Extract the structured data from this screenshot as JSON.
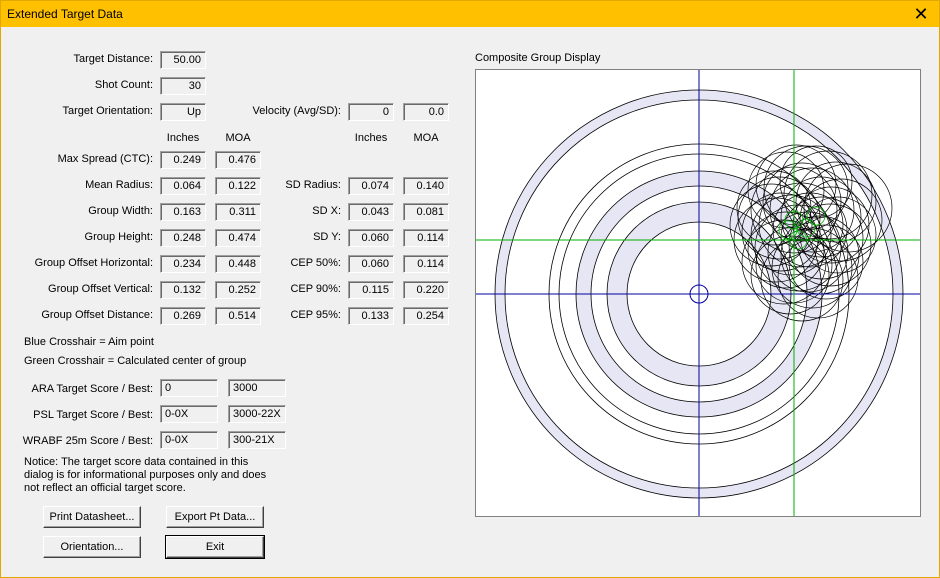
{
  "window": {
    "title": "Extended Target Data",
    "close_glyph": "✕"
  },
  "top": {
    "target_distance_label": "Target Distance:",
    "target_distance": "50.00",
    "shot_count_label": "Shot Count:",
    "shot_count": "30",
    "target_orientation_label": "Target Orientation:",
    "target_orientation": "Up",
    "velocity_label": "Velocity (Avg/SD):",
    "velocity_avg": "0",
    "velocity_sd": "0.0"
  },
  "headers": {
    "inches": "Inches",
    "moa": "MOA"
  },
  "left_rows": [
    {
      "label": "Max Spread (CTC):",
      "inches": "0.249",
      "moa": "0.476"
    },
    {
      "label": "Mean Radius:",
      "inches": "0.064",
      "moa": "0.122"
    },
    {
      "label": "Group Width:",
      "inches": "0.163",
      "moa": "0.311"
    },
    {
      "label": "Group Height:",
      "inches": "0.248",
      "moa": "0.474"
    },
    {
      "label": "Group Offset Horizontal:",
      "inches": "0.234",
      "moa": "0.448"
    },
    {
      "label": "Group Offset Vertical:",
      "inches": "0.132",
      "moa": "0.252"
    },
    {
      "label": "Group Offset Distance:",
      "inches": "0.269",
      "moa": "0.514"
    }
  ],
  "right_rows": [
    {
      "label": "SD Radius:",
      "inches": "0.074",
      "moa": "0.140"
    },
    {
      "label": "SD X:",
      "inches": "0.043",
      "moa": "0.081"
    },
    {
      "label": "SD Y:",
      "inches": "0.060",
      "moa": "0.114"
    },
    {
      "label": "CEP 50%:",
      "inches": "0.060",
      "moa": "0.114"
    },
    {
      "label": "CEP 90%:",
      "inches": "0.115",
      "moa": "0.220"
    },
    {
      "label": "CEP 95%:",
      "inches": "0.133",
      "moa": "0.254"
    }
  ],
  "legend": {
    "blue": "Blue Crosshair = Aim point",
    "green": "Green Crosshair = Calculated center of group"
  },
  "scores": [
    {
      "label": "ARA Target Score / Best:",
      "score": "0",
      "best": "3000"
    },
    {
      "label": "PSL Target Score / Best:",
      "score": "0-0X",
      "best": "3000-22X"
    },
    {
      "label": "WRABF 25m Score / Best:",
      "score": "0-0X",
      "best": "300-21X"
    }
  ],
  "notice": "Notice: The target score data contained in this dialog is for informational purposes only and does not reflect an official target score.",
  "buttons": {
    "print": "Print Datasheet...",
    "export": "Export Pt Data...",
    "orientation": "Orientation...",
    "exit": "Exit"
  },
  "display": {
    "title": "Composite Group Display",
    "colors": {
      "aim": "#0000a0",
      "center": "#00b000",
      "ring_fill": "#e6e6f5",
      "shot": "#000000"
    }
  }
}
